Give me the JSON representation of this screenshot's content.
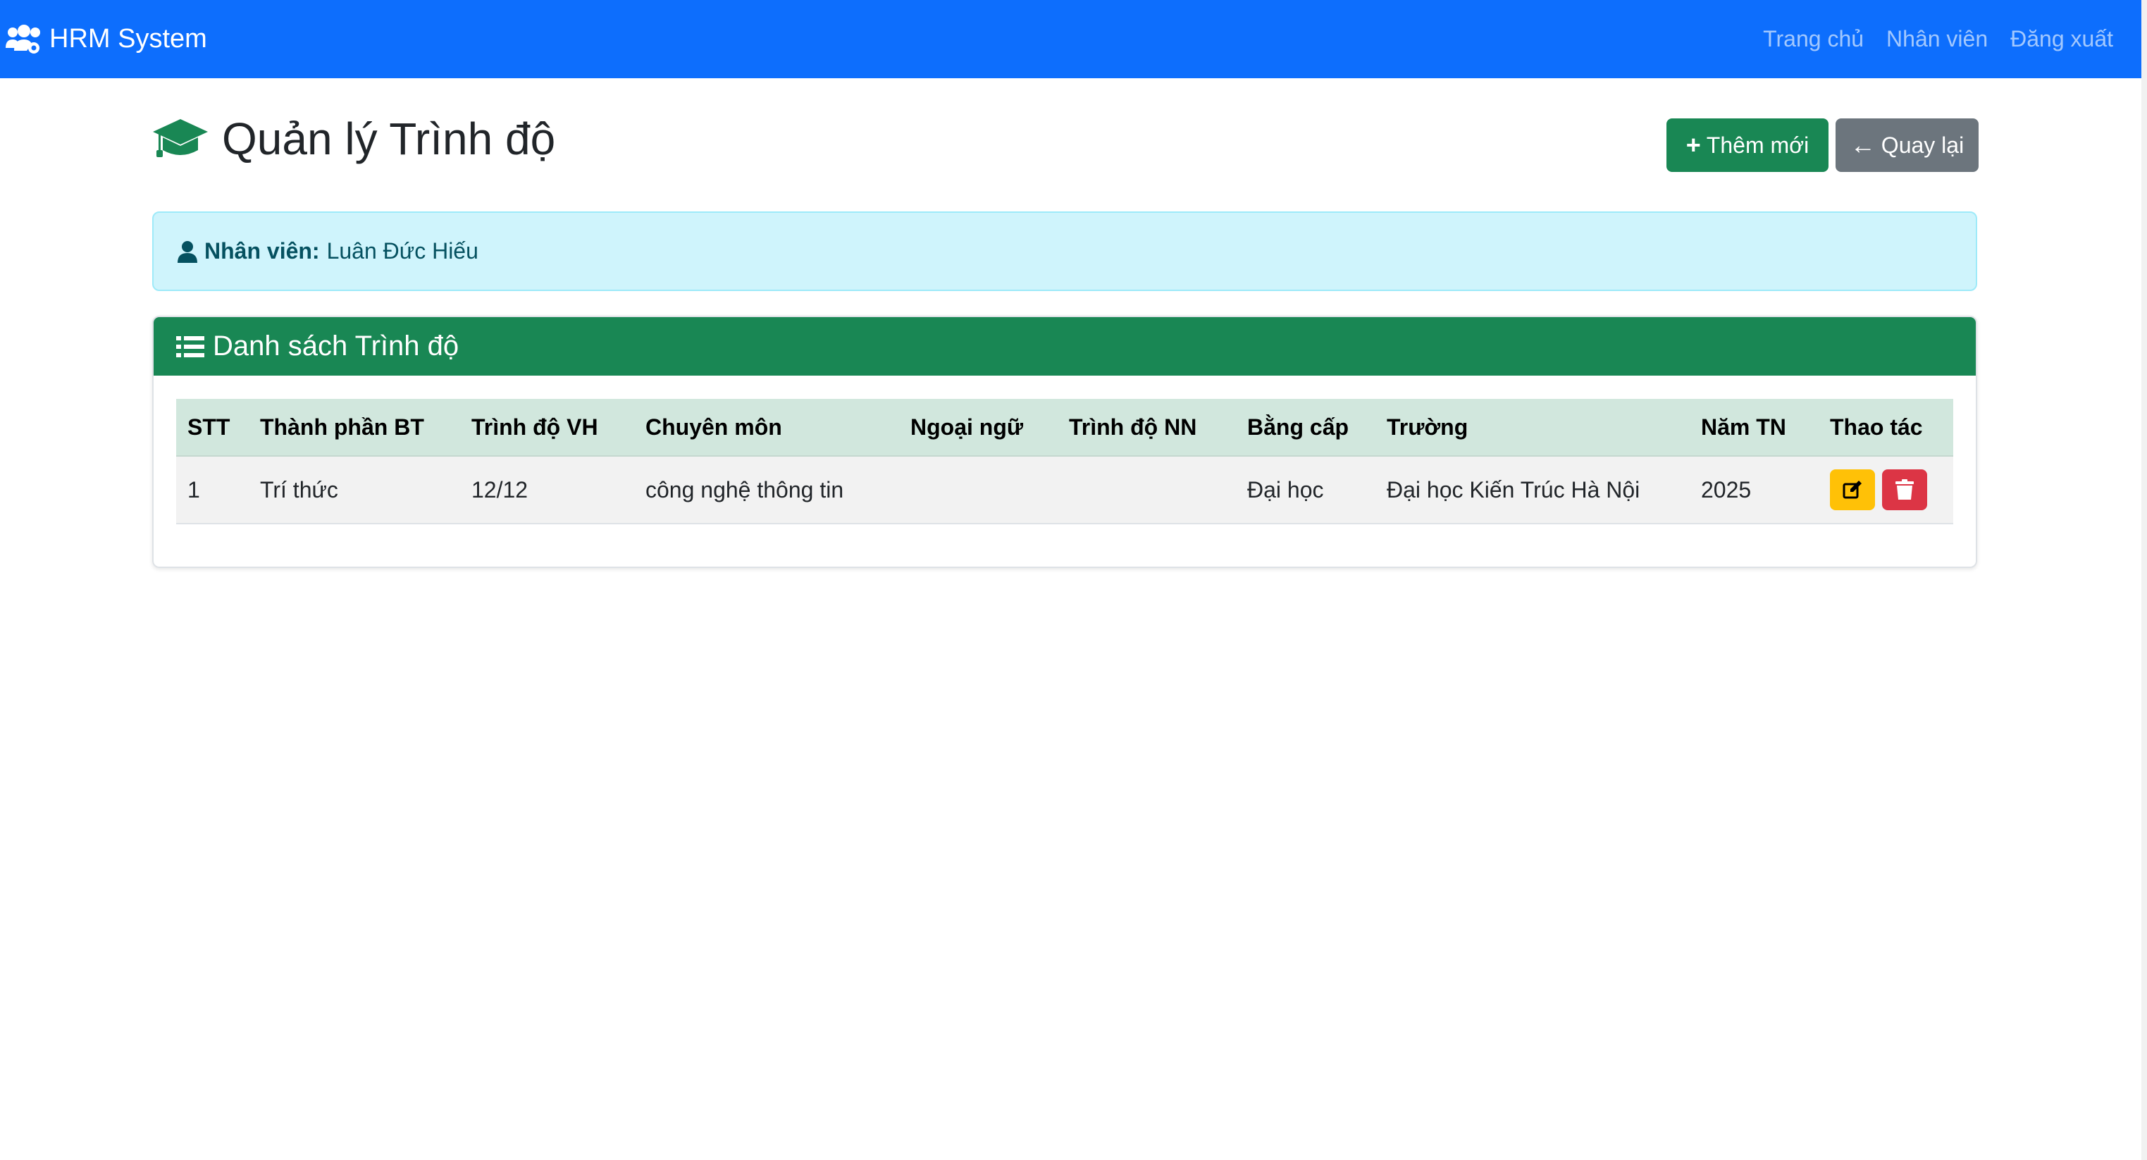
{
  "navbar": {
    "brand": "HRM System",
    "brand_icon": "users-cog-icon",
    "links": [
      "Trang chủ",
      "Nhân viên",
      "Đăng xuất"
    ],
    "color": "#0d6efd"
  },
  "page": {
    "title": "Quản lý Trình độ",
    "title_icon": "graduation-cap-icon",
    "add_button": "Thêm mới",
    "back_button": "Quay lại"
  },
  "employee": {
    "label": "Nhân viên:",
    "name": "Luân Đức Hiếu"
  },
  "card": {
    "title": "Danh sách Trình độ",
    "columns": [
      "STT",
      "Thành phần BT",
      "Trình độ VH",
      "Chuyên môn",
      "Ngoại ngữ",
      "Trình độ NN",
      "Bằng cấp",
      "Trường",
      "Năm TN",
      "Thao tác"
    ],
    "rows": [
      {
        "stt": "1",
        "thanh_phan_bt": "Trí thức",
        "trinh_do_vh": "12/12",
        "chuyen_mon": "công nghệ thông tin",
        "ngoai_ngu": "",
        "trinh_do_nn": "",
        "bang_cap": "Đại học",
        "truong": "Đại học Kiến Trúc Hà Nội",
        "nam_tn": "2025"
      }
    ]
  },
  "colors": {
    "success": "#198754",
    "secondary": "#6c757d",
    "warning": "#ffc107",
    "danger": "#dc3545",
    "info_bg": "#cff4fc",
    "table_head": "#d1e7dd"
  }
}
